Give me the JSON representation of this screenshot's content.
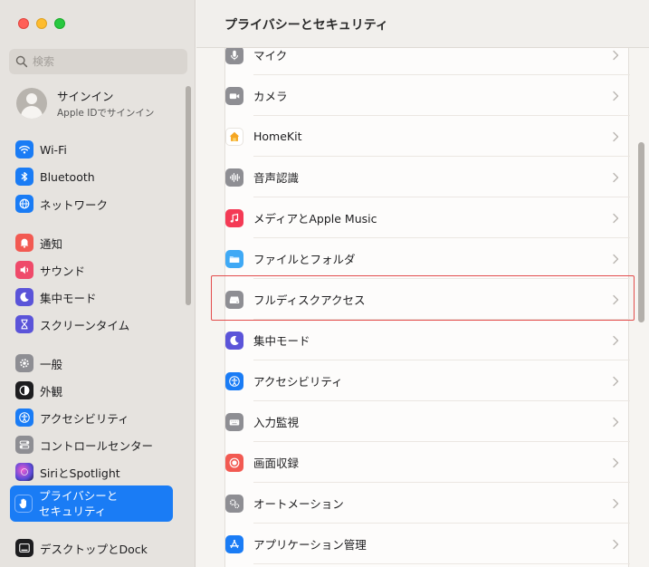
{
  "window": {
    "title": "プライバシーとセキュリティ"
  },
  "search": {
    "placeholder": "検索"
  },
  "account": {
    "name": "サインイン",
    "subtitle": "Apple IDでサインイン"
  },
  "sidebar": {
    "items": [
      {
        "label": "Wi-Fi",
        "icon": "wifi-icon",
        "color": "#1a7cf5"
      },
      {
        "label": "Bluetooth",
        "icon": "bluetooth-icon",
        "color": "#1a7cf5"
      },
      {
        "label": "ネットワーク",
        "icon": "globe-icon",
        "color": "#1a7cf5"
      },
      {
        "label": "通知",
        "icon": "bell-icon",
        "color": "#f25a52"
      },
      {
        "label": "サウンド",
        "icon": "speaker-icon",
        "color": "#ef4a6a"
      },
      {
        "label": "集中モード",
        "icon": "moon-icon",
        "color": "#5b54d9"
      },
      {
        "label": "スクリーンタイム",
        "icon": "hourglass-icon",
        "color": "#5b54d9"
      },
      {
        "label": "一般",
        "icon": "gear-icon",
        "color": "#8e8e93"
      },
      {
        "label": "外観",
        "icon": "appearance-icon",
        "color": "#1d1d1f"
      },
      {
        "label": "アクセシビリティ",
        "icon": "accessibility-icon",
        "color": "#1a7cf5"
      },
      {
        "label": "コントロールセンター",
        "icon": "control-center-icon",
        "color": "#8e8e93"
      },
      {
        "label": "SiriとSpotlight",
        "icon": "siri-icon",
        "color": "#a14fd6"
      },
      {
        "label": "プライバシーと\nセキュリティ",
        "icon": "hand-icon",
        "color": "#1a7cf5",
        "selected": true
      },
      {
        "label": "デスクトップとDock",
        "icon": "dock-icon",
        "color": "#1d1d1f"
      }
    ]
  },
  "list": {
    "rows": [
      {
        "label": "マイク",
        "icon": "microphone-icon",
        "color": "#8e8e93"
      },
      {
        "label": "カメラ",
        "icon": "camera-icon",
        "color": "#8e8e93"
      },
      {
        "label": "HomeKit",
        "icon": "home-icon",
        "color": "#f5a623"
      },
      {
        "label": "音声認識",
        "icon": "waveform-icon",
        "color": "#8e8e93"
      },
      {
        "label": "メディアとApple Music",
        "icon": "music-icon",
        "color": "#f43a55"
      },
      {
        "label": "ファイルとフォルダ",
        "icon": "folder-icon",
        "color": "#3fa9f5"
      },
      {
        "label": "フルディスクアクセス",
        "icon": "disk-icon",
        "color": "#8e8e93"
      },
      {
        "label": "集中モード",
        "icon": "moon-icon",
        "color": "#5b54d9"
      },
      {
        "label": "アクセシビリティ",
        "icon": "accessibility-icon",
        "color": "#1a7cf5"
      },
      {
        "label": "入力監視",
        "icon": "keyboard-icon",
        "color": "#8e8e93"
      },
      {
        "label": "画面収録",
        "icon": "record-icon",
        "color": "#f25a52"
      },
      {
        "label": "オートメーション",
        "icon": "gears-icon",
        "color": "#8e8e93"
      },
      {
        "label": "アプリケーション管理",
        "icon": "appstore-icon",
        "color": "#1a7cf5"
      }
    ]
  }
}
